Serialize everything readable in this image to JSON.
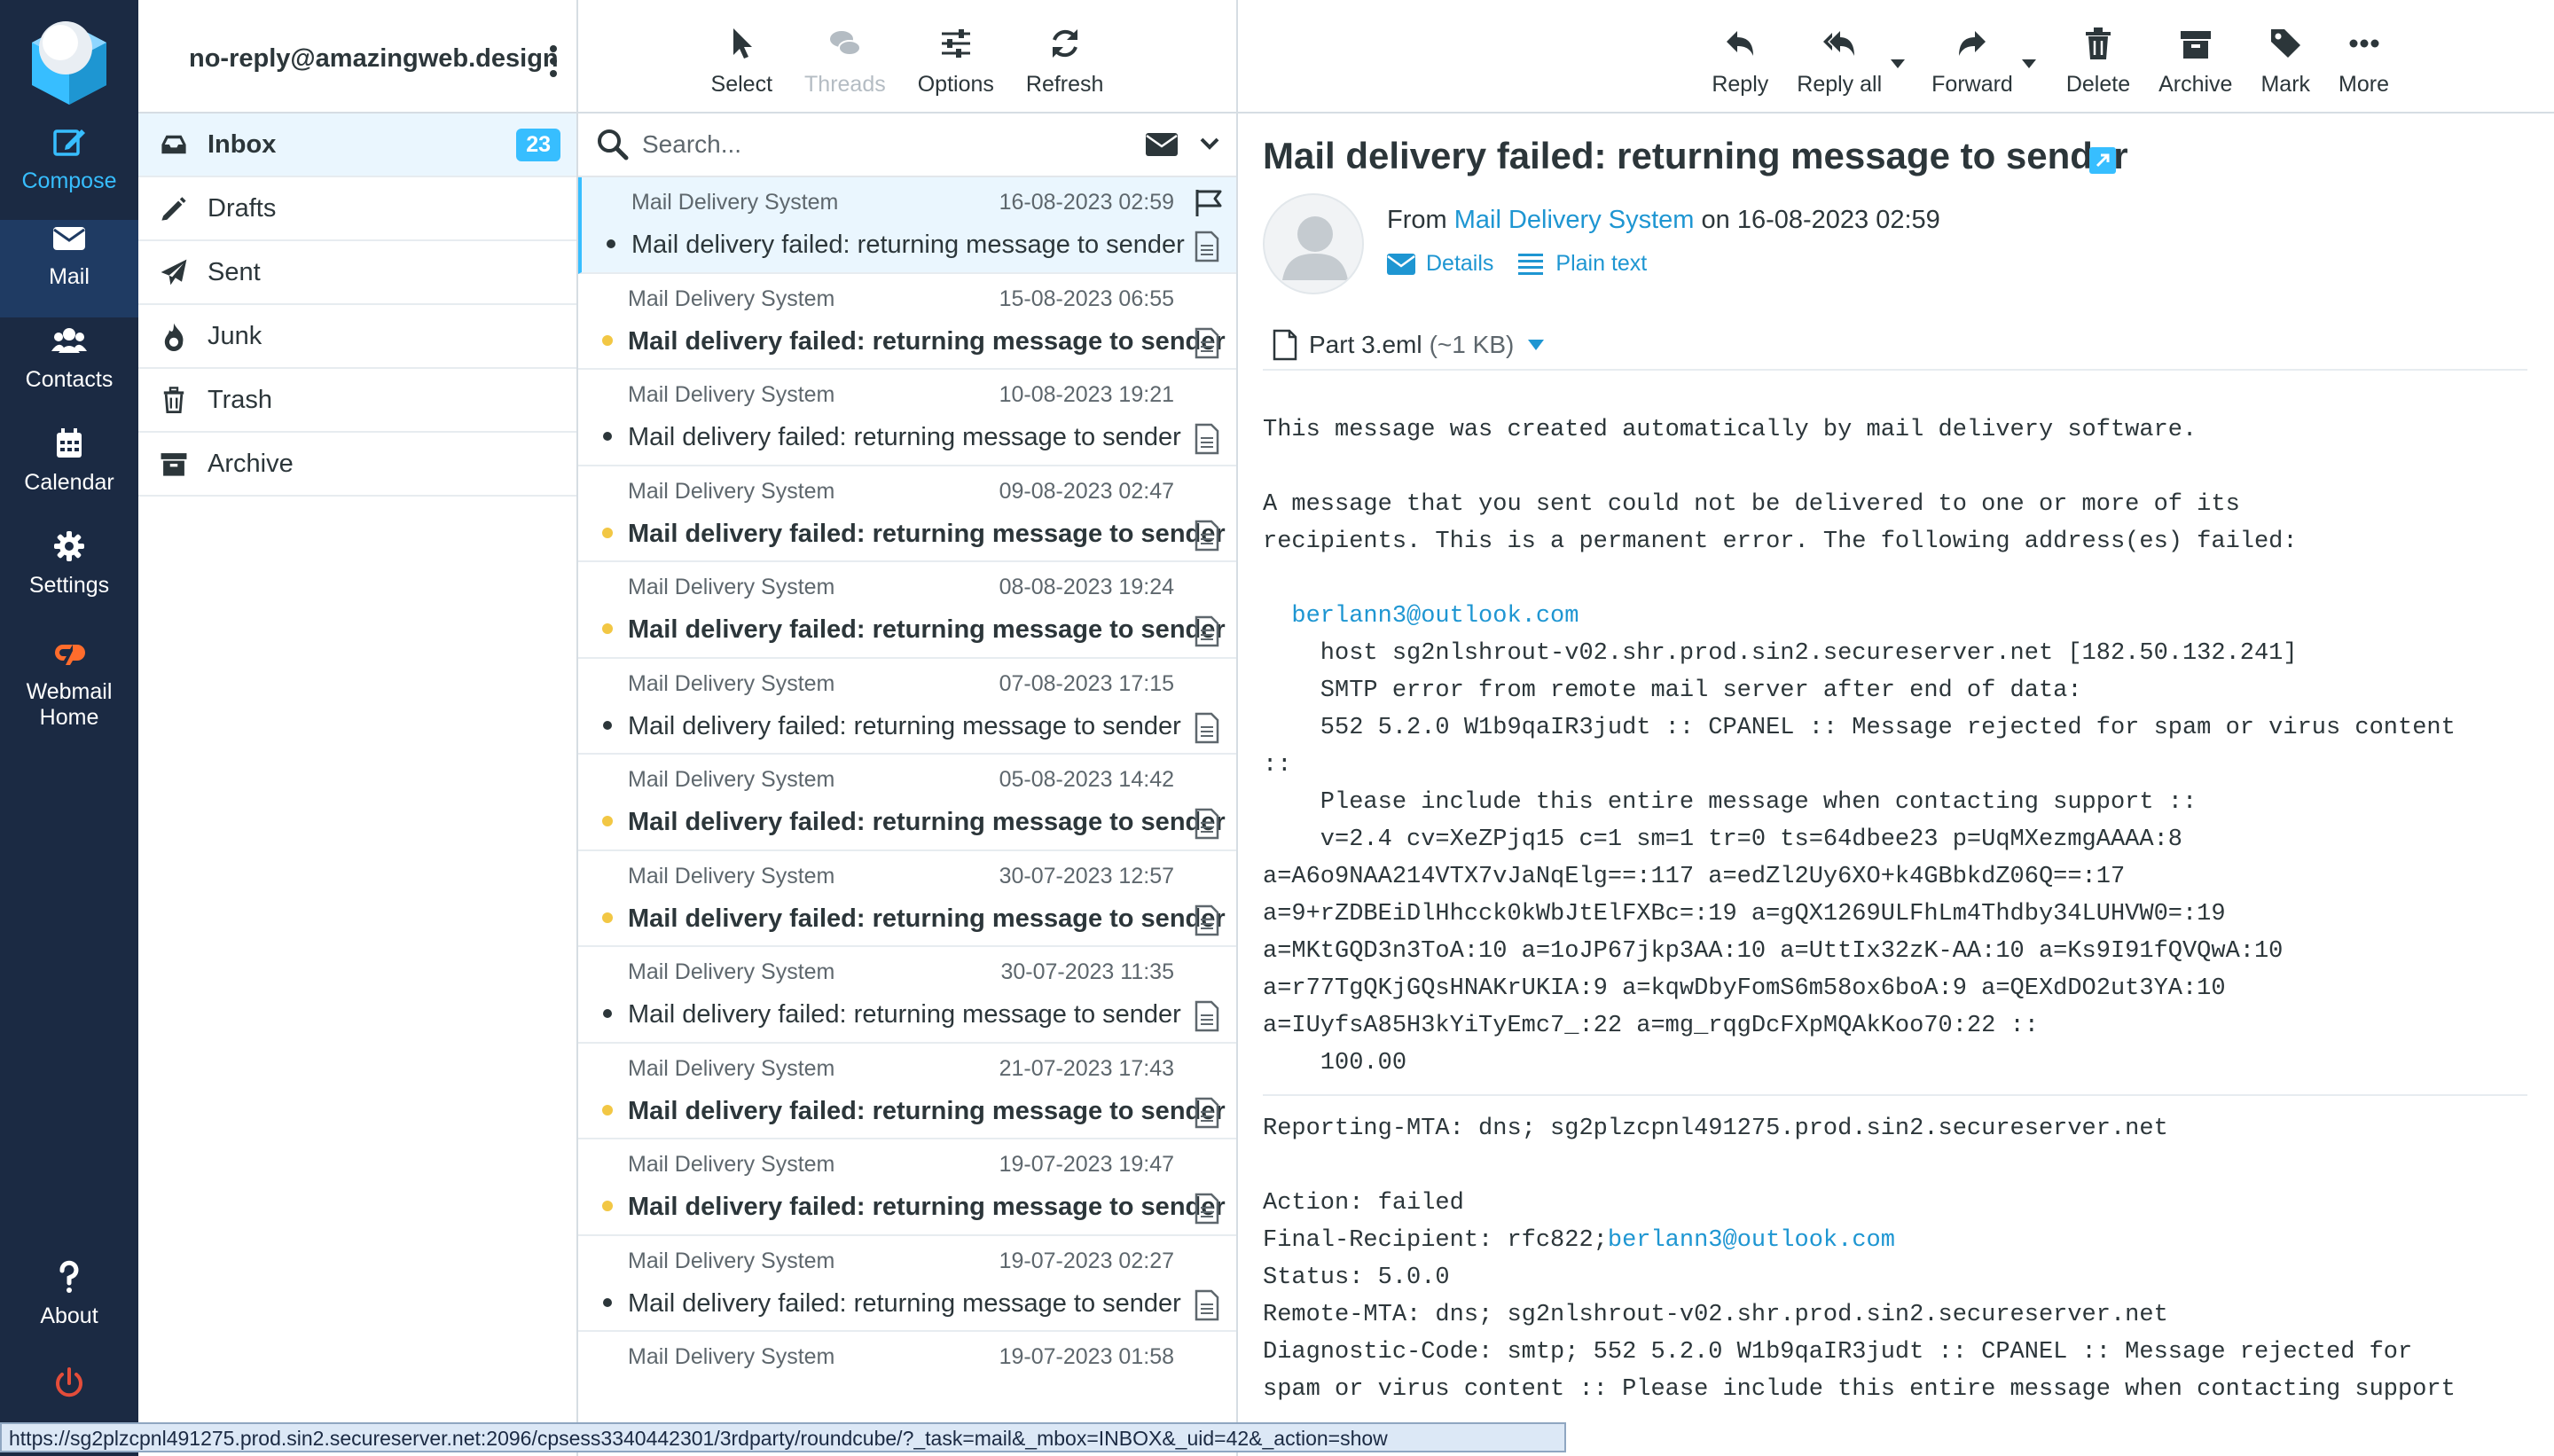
{
  "nav": {
    "compose": "Compose",
    "mail": "Mail",
    "contacts": "Contacts",
    "calendar": "Calendar",
    "settings": "Settings",
    "webmail_line1": "Webmail",
    "webmail_line2": "Home",
    "about": "About"
  },
  "account": "no-reply@amazingweb.design",
  "folders": [
    {
      "label": "Inbox",
      "badge": "23"
    },
    {
      "label": "Drafts"
    },
    {
      "label": "Sent"
    },
    {
      "label": "Junk"
    },
    {
      "label": "Trash"
    },
    {
      "label": "Archive"
    }
  ],
  "list_toolbar": {
    "select": "Select",
    "threads": "Threads",
    "options": "Options",
    "refresh": "Refresh"
  },
  "search": {
    "placeholder": "Search..."
  },
  "messages": [
    {
      "from": "Mail Delivery System",
      "date": "16-08-2023 02:59",
      "subject": "Mail delivery failed: returning message to sender",
      "unread": false
    },
    {
      "from": "Mail Delivery System",
      "date": "15-08-2023 06:55",
      "subject": "Mail delivery failed: returning message to sender",
      "unread": true
    },
    {
      "from": "Mail Delivery System",
      "date": "10-08-2023 19:21",
      "subject": "Mail delivery failed: returning message to sender",
      "unread": false
    },
    {
      "from": "Mail Delivery System",
      "date": "09-08-2023 02:47",
      "subject": "Mail delivery failed: returning message to sender",
      "unread": true
    },
    {
      "from": "Mail Delivery System",
      "date": "08-08-2023 19:24",
      "subject": "Mail delivery failed: returning message to sender",
      "unread": true
    },
    {
      "from": "Mail Delivery System",
      "date": "07-08-2023 17:15",
      "subject": "Mail delivery failed: returning message to sender",
      "unread": false
    },
    {
      "from": "Mail Delivery System",
      "date": "05-08-2023 14:42",
      "subject": "Mail delivery failed: returning message to sender",
      "unread": true
    },
    {
      "from": "Mail Delivery System",
      "date": "30-07-2023 12:57",
      "subject": "Mail delivery failed: returning message to sender",
      "unread": true
    },
    {
      "from": "Mail Delivery System",
      "date": "30-07-2023 11:35",
      "subject": "Mail delivery failed: returning message to sender",
      "unread": false
    },
    {
      "from": "Mail Delivery System",
      "date": "21-07-2023 17:43",
      "subject": "Mail delivery failed: returning message to sender",
      "unread": true
    },
    {
      "from": "Mail Delivery System",
      "date": "19-07-2023 19:47",
      "subject": "Mail delivery failed: returning message to sender",
      "unread": true
    },
    {
      "from": "Mail Delivery System",
      "date": "19-07-2023 02:27",
      "subject": "Mail delivery failed: returning message to sender",
      "unread": false
    },
    {
      "from": "Mail Delivery System",
      "date": "19-07-2023 01:58",
      "subject": "",
      "unread": false
    }
  ],
  "preview_toolbar": {
    "reply": "Reply",
    "reply_all": "Reply all",
    "forward": "Forward",
    "delete": "Delete",
    "archive": "Archive",
    "mark": "Mark",
    "more": "More"
  },
  "preview": {
    "subject": "Mail delivery failed: returning message to sender",
    "from_prefix": "From",
    "from_name": "Mail Delivery System",
    "date_prefix": "on",
    "date": "16-08-2023 02:59",
    "details": "Details",
    "plain_text": "Plain text",
    "attachment_name": "Part 3.eml",
    "attachment_size": "(~1 KB)"
  },
  "body": {
    "l1": "This message was created automatically by mail delivery software.",
    "l2": "A message that you sent could not be delivered to one or more of its",
    "l3": "recipients. This is a permanent error. The following address(es) failed:",
    "recipient": "berlann3@outlook.com",
    "l4": "    host sg2nlshrout-v02.shr.prod.sin2.secureserver.net [182.50.132.241]",
    "l5": "    SMTP error from remote mail server after end of data:",
    "l6": "    552 5.2.0 W1b9qaIR3judt :: CPANEL :: Message rejected for spam or virus content",
    "l7": "::",
    "l8": "    Please include this entire message when contacting support ::",
    "l9": "    v=2.4 cv=XeZPjq15 c=1 sm=1 tr=0 ts=64dbee23 p=UqMXezmgAAAA:8",
    "l10": "a=A6o9NAA214VTX7vJaNqElg==:117 a=edZl2Uy6XO+k4GBbkdZ06Q==:17",
    "l11": "a=9+rZDBEiDlHhcck0kWbJtElFXBc=:19 a=gQX1269ULFhLm4Thdby34LUHVW0=:19",
    "l12": "a=MKtGQD3n3ToA:10 a=1oJP67jkp3AA:10 a=UttIx32zK-AA:10 a=Ks9I91fQVQwA:10",
    "l13": "a=r77TgQKjGQsHNAKrUKIA:9 a=kqwDbyFomS6m58ox6boA:9 a=QEXdDO2ut3YA:10",
    "l14": "a=IUyfsA85H3kYiTyEmc7_:22 a=mg_rqgDcFXpMQAkKoo70:22 ::",
    "l15": "    100.00",
    "l16": "Reporting-MTA: dns; sg2plzcpnl491275.prod.sin2.secureserver.net",
    "l17": "Action: failed",
    "l18_prefix": "Final-Recipient: rfc822;",
    "l19": "Status: 5.0.0",
    "l20": "Remote-MTA: dns; sg2nlshrout-v02.shr.prod.sin2.secureserver.net",
    "l21": "Diagnostic-Code: smtp; 552 5.2.0 W1b9qaIR3judt :: CPANEL :: Message rejected for",
    "l22": "spam or virus content :: Please include this entire message when contacting support"
  },
  "statusbar": "https://sg2plzcpnl491275.prod.sin2.secureserver.net:2096/cpsess3340442301/3rdparty/roundcube/?_task=mail&_mbox=INBOX&_uid=42&_action=show"
}
